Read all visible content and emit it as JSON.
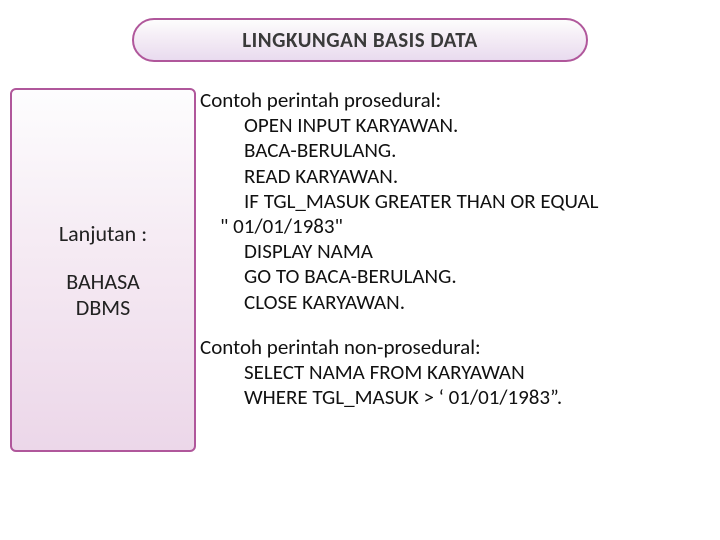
{
  "title": "LINGKUNGAN BASIS DATA",
  "sidebar": {
    "line1": "Lanjutan :",
    "line2a": "BAHASA",
    "line2b": "DBMS"
  },
  "sec1": {
    "heading": "Contoh perintah prosedural:",
    "l1": "OPEN INPUT KARYAWAN.",
    "l2": "BACA-BERULANG.",
    "l3": "READ KARYAWAN.",
    "l4": "IF TGL_MASUK GREATER THAN OR EQUAL",
    "l5": "\" 01/01/1983\"",
    "l6": "DISPLAY NAMA",
    "l7": "GO TO BACA-BERULANG.",
    "l8": "CLOSE KARYAWAN."
  },
  "sec2": {
    "heading": "Contoh perintah non-prosedural:",
    "l1": "SELECT NAMA FROM KARYAWAN",
    "l2": "WHERE TGL_MASUK > ‘ 01/01/1983”."
  }
}
